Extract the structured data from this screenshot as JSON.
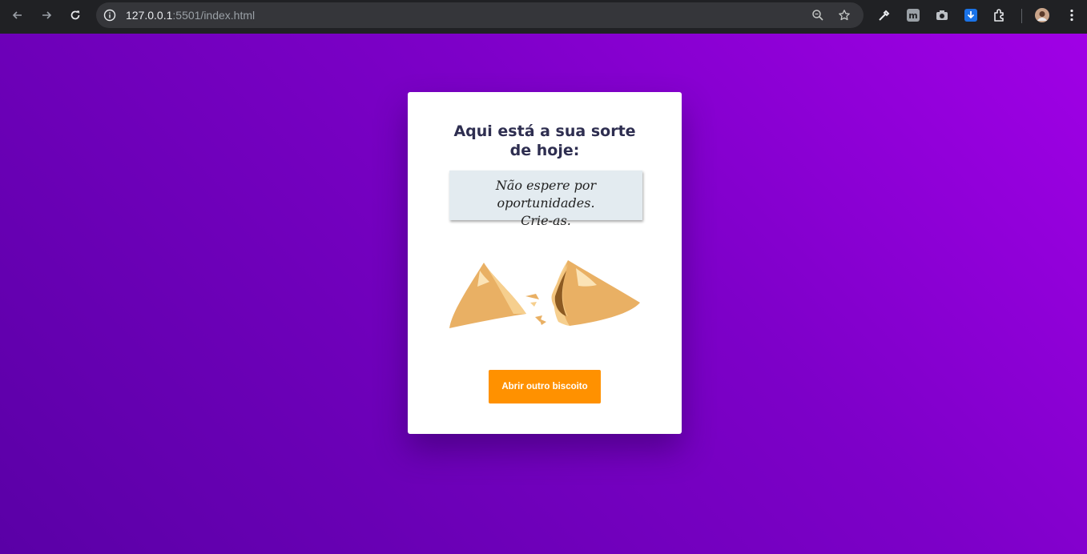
{
  "browser": {
    "url_host": "127.0.0.1",
    "url_path": ":5501/index.html"
  },
  "card": {
    "title_line1": "Aqui está a sua sorte",
    "title_line2": "de hoje:",
    "fortune_line1": "Não espere por oportunidades.",
    "fortune_line2": "Crie-as.",
    "button_label": "Abrir outro biscoito"
  },
  "colors": {
    "accent": "#ff9100",
    "title": "#2e2e50",
    "fortune_bg": "#e3ebf0"
  }
}
